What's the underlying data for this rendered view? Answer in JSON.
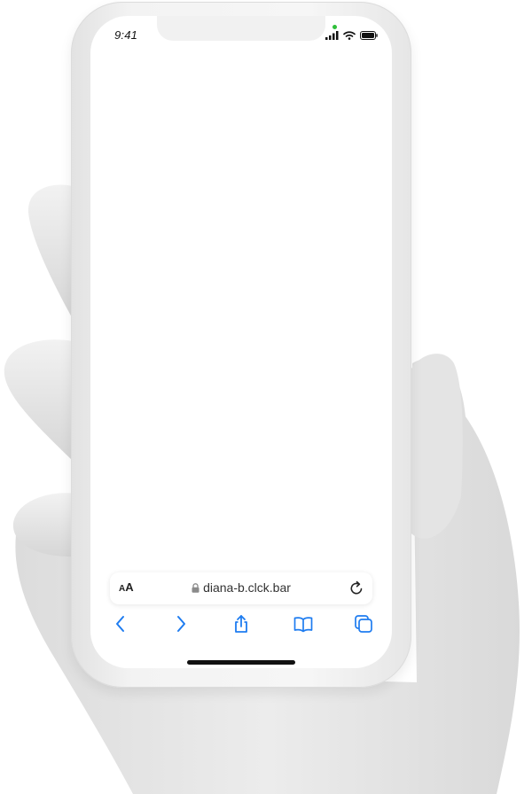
{
  "status_bar": {
    "time": "9:41",
    "icons": [
      "signal-icon",
      "wifi-icon",
      "battery-icon"
    ],
    "camera_indicator_color": "#2fbf3a"
  },
  "address_bar": {
    "text_size_label_small": "A",
    "text_size_label_large": "A",
    "url": "diana-b.clck.bar",
    "lock_icon": "lock-icon",
    "reload_icon": "reload-icon"
  },
  "toolbar": {
    "items": [
      {
        "name": "back-button",
        "icon": "chevron-left-icon"
      },
      {
        "name": "forward-button",
        "icon": "chevron-right-icon"
      },
      {
        "name": "share-button",
        "icon": "share-icon"
      },
      {
        "name": "bookmarks-button",
        "icon": "book-icon"
      },
      {
        "name": "tabs-button",
        "icon": "tabs-icon"
      }
    ],
    "accent_color": "#1e7cf0"
  }
}
